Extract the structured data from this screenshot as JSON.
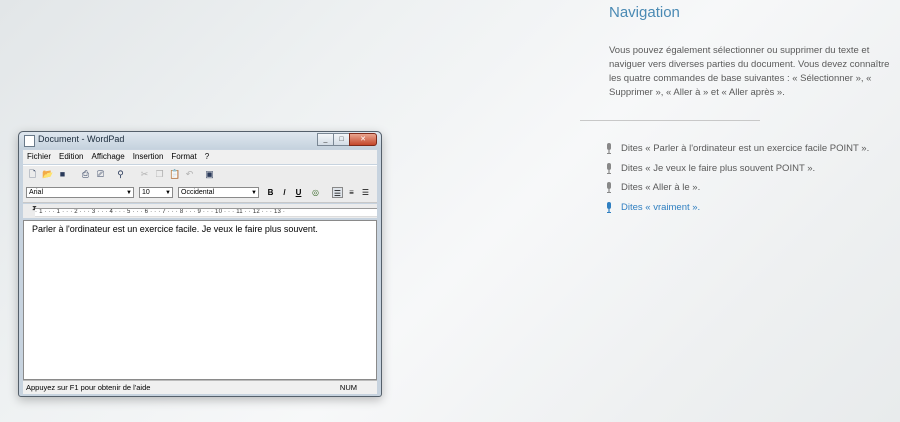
{
  "wordpad": {
    "title": "Document - WordPad",
    "window_buttons": [
      "_",
      "□",
      "✕"
    ],
    "menu": [
      "Fichier",
      "Edition",
      "Affichage",
      "Insertion",
      "Format",
      "?"
    ],
    "toolbar_icons": [
      "new-icon",
      "open-icon",
      "save-icon",
      "print-icon",
      "print-preview-icon",
      "find-icon",
      "cut-icon",
      "copy-icon",
      "paste-icon",
      "undo-icon",
      "date-time-icon"
    ],
    "font_name": "Arial",
    "font_size": "10",
    "script": "Occidental",
    "format_buttons": {
      "bold": "B",
      "italic": "/",
      "underline": "U"
    },
    "ruler": "· 1 · · · 1 · · · 2 · · · 3 · · · 4 · · · 5 · · · 6 · · · 7 · · · 8 · · · 9 · · · 10 · · · 11 · · 12 · · · 13 ·",
    "document_text": "Parler à l'ordinateur est un exercice facile.  Je veux le faire plus souvent.",
    "status_left": "Appuyez sur F1 pour obtenir de l'aide",
    "status_right": "NUM"
  },
  "panel": {
    "title": "Navigation",
    "paragraph": "Vous pouvez également sélectionner ou supprimer du texte et naviguer vers diverses parties du document.  Vous devez connaître les quatre commandes de base suivantes : « Sélectionner », « Supprimer », « Aller à » et « Aller après ».",
    "commands": [
      {
        "text": "Dites « Parler à l'ordinateur est un exercice facile POINT »."
      },
      {
        "text": "Dites « Je veux le faire plus souvent POINT »."
      },
      {
        "text": "Dites « Aller à le »."
      },
      {
        "text": "Dites « vraiment »."
      }
    ],
    "colors": {
      "accent": "#2f7fc1",
      "text": "#5a5a5a",
      "title": "#4a8ab4"
    }
  }
}
